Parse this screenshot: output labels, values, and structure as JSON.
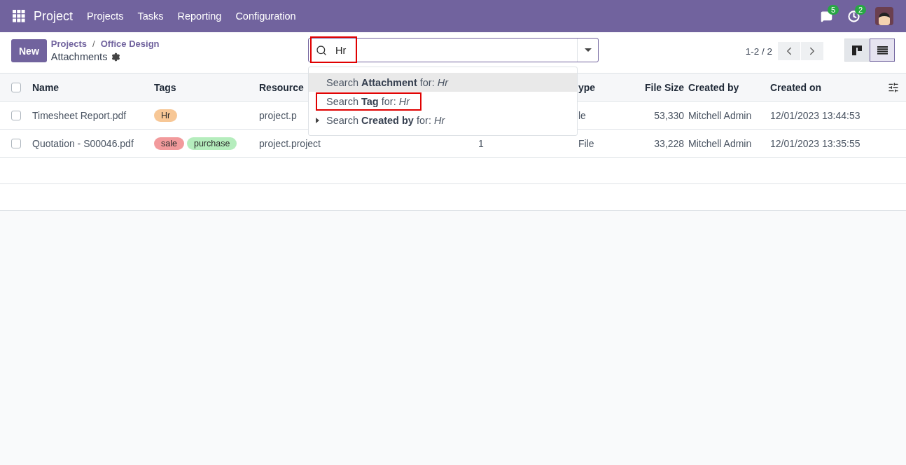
{
  "navbar": {
    "app": "Project",
    "menu": [
      "Projects",
      "Tasks",
      "Reporting",
      "Configuration"
    ],
    "messages_count": "5",
    "activities_count": "2"
  },
  "control_panel": {
    "new_button": "New",
    "breadcrumbs": [
      "Projects",
      "Office Design"
    ],
    "breadcrumb_separator": "/",
    "title": "Attachments",
    "pager": "1-2 / 2",
    "views": [
      {
        "kind": "kanban",
        "selected": false
      },
      {
        "kind": "list",
        "selected": true
      }
    ]
  },
  "search": {
    "value": "Hr",
    "highlighted": true
  },
  "search_suggestions": [
    {
      "text": "Search **Attachment** for: *Hr*",
      "selected": true,
      "expandable": false,
      "highlighted": false
    },
    {
      "text": "Search **Tag** for: *Hr*",
      "selected": false,
      "expandable": false,
      "highlighted": true
    },
    {
      "text": "Search **Created by** for: *Hr*",
      "selected": false,
      "expandable": true,
      "highlighted": false
    }
  ],
  "table": {
    "select_all_checked": false,
    "columns": [
      {
        "label": "Name",
        "kind": "text"
      },
      {
        "label": "Tags",
        "kind": "tags"
      },
      {
        "label": "Resource",
        "kind": "text"
      },
      {
        "kind": "id"
      },
      {
        "label": "ype",
        "kind": "text"
      },
      {
        "label": "File Size",
        "kind": "number"
      },
      {
        "label": "Created by",
        "kind": "text"
      },
      {
        "label": "Created on",
        "kind": "text"
      }
    ],
    "rows": [
      {
        "checked": false,
        "name": "Timesheet Report.pdf",
        "tags": [
          {
            "label": "Hr",
            "color": "#f7c796"
          }
        ],
        "resource": "project.p",
        "type": "le",
        "file_size": "53,330",
        "created_by": "Mitchell Admin",
        "created_on": "12/01/2023 13:44:53"
      },
      {
        "checked": false,
        "name": "Quotation - S00046.pdf",
        "tags": [
          {
            "label": "sale",
            "color": "#f29a9c"
          },
          {
            "label": "purchase",
            "color": "#b5edbd"
          }
        ],
        "resource": "project.project",
        "column_4": "1",
        "type": "File",
        "file_size": "33,228",
        "created_by": "Mitchell Admin",
        "created_on": "12/01/2023 13:35:55"
      }
    ]
  }
}
